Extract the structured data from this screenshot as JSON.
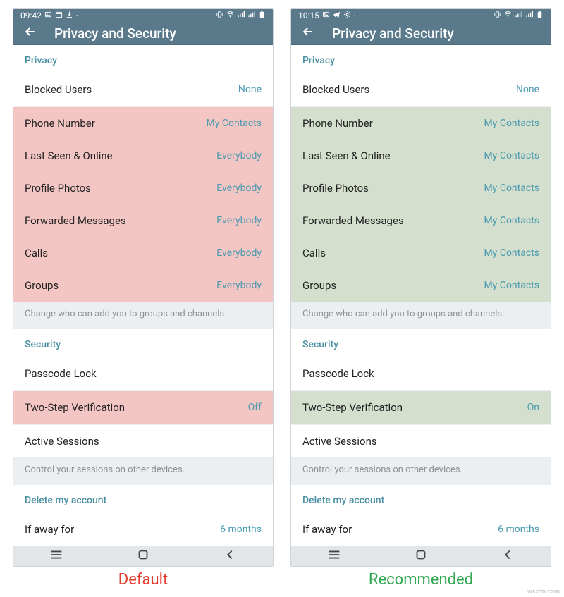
{
  "left": {
    "statusbar": {
      "time": "09:42"
    },
    "header": {
      "title": "Privacy and Security"
    },
    "sections": {
      "privacy_header": "Privacy",
      "blocked_users": {
        "label": "Blocked Users",
        "value": "None"
      },
      "items": [
        {
          "label": "Phone Number",
          "value": "My Contacts"
        },
        {
          "label": "Last Seen & Online",
          "value": "Everybody"
        },
        {
          "label": "Profile Photos",
          "value": "Everybody"
        },
        {
          "label": "Forwarded Messages",
          "value": "Everybody"
        },
        {
          "label": "Calls",
          "value": "Everybody"
        },
        {
          "label": "Groups",
          "value": "Everybody"
        }
      ],
      "groups_helper": "Change who can add you to groups and channels.",
      "security_header": "Security",
      "passcode": {
        "label": "Passcode Lock"
      },
      "twostep": {
        "label": "Two-Step Verification",
        "value": "Off"
      },
      "sessions": {
        "label": "Active Sessions"
      },
      "sessions_helper": "Control your sessions on other devices.",
      "delete_header": "Delete my account",
      "away": {
        "label": "If away for",
        "value": "6 months"
      }
    },
    "caption": "Default"
  },
  "right": {
    "statusbar": {
      "time": "10:15"
    },
    "header": {
      "title": "Privacy and Security"
    },
    "sections": {
      "privacy_header": "Privacy",
      "blocked_users": {
        "label": "Blocked Users",
        "value": "None"
      },
      "items": [
        {
          "label": "Phone Number",
          "value": "My Contacts"
        },
        {
          "label": "Last Seen & Online",
          "value": "My Contacts"
        },
        {
          "label": "Profile Photos",
          "value": "My Contacts"
        },
        {
          "label": "Forwarded Messages",
          "value": "My Contacts"
        },
        {
          "label": "Calls",
          "value": "My Contacts"
        },
        {
          "label": "Groups",
          "value": "My Contacts"
        }
      ],
      "groups_helper": "Change who can add you to groups and channels.",
      "security_header": "Security",
      "passcode": {
        "label": "Passcode Lock"
      },
      "twostep": {
        "label": "Two-Step Verification",
        "value": "On"
      },
      "sessions": {
        "label": "Active Sessions"
      },
      "sessions_helper": "Control your sessions on other devices.",
      "delete_header": "Delete my account",
      "away": {
        "label": "If away for",
        "value": "6 months"
      }
    },
    "caption": "Recommended"
  },
  "watermark": "wsxdn.com"
}
